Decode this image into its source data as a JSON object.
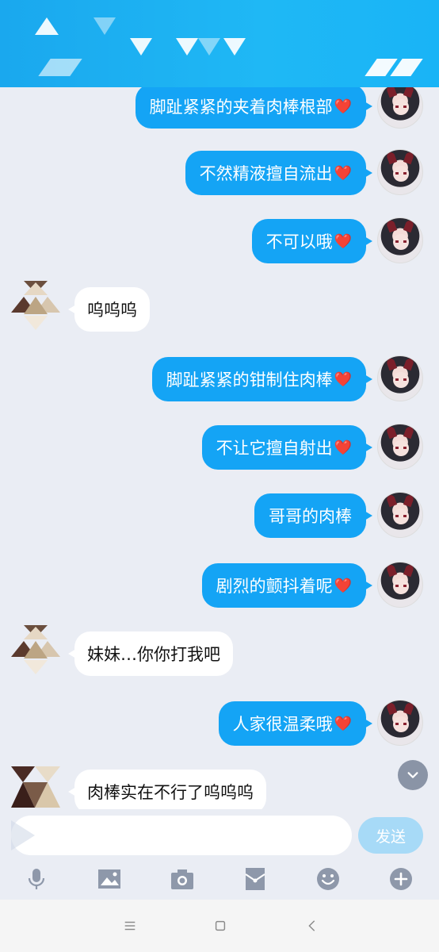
{
  "messages": [
    {
      "side": "out",
      "text": "脚趾紧紧的夹着肉棒根部",
      "heart": true
    },
    {
      "side": "out",
      "text": "不然精液擅自流出",
      "heart": true
    },
    {
      "side": "out",
      "text": "不可以哦",
      "heart": true
    },
    {
      "side": "in",
      "text": "呜呜呜",
      "heart": false
    },
    {
      "side": "out",
      "text": "脚趾紧紧的钳制住肉棒",
      "heart": true
    },
    {
      "side": "out",
      "text": "不让它擅自射出",
      "heart": true
    },
    {
      "side": "out",
      "text": "哥哥的肉棒",
      "heart": false
    },
    {
      "side": "out",
      "text": "剧烈的颤抖着呢",
      "heart": true
    },
    {
      "side": "in",
      "text": "妹妹…你你打我吧",
      "heart": false
    },
    {
      "side": "out",
      "text": "人家很温柔哦",
      "heart": true
    },
    {
      "side": "in",
      "text": "肉棒实在不行了呜呜呜",
      "heart": false
    }
  ],
  "heart_glyph": "❤️",
  "composer": {
    "input_value": "",
    "send_label": "发送"
  },
  "toolbar": [
    "microphone-icon",
    "image-icon",
    "camera-icon",
    "red-packet-icon",
    "emoji-icon",
    "plus-icon"
  ],
  "colors": {
    "outgoing_bubble": "#14a4f5",
    "incoming_bubble": "#ffffff",
    "background": "#eaedf4",
    "header": "#1fb8f5",
    "send_button": "#a7daf7"
  },
  "scroll_down_icon": "chevron-down-icon"
}
